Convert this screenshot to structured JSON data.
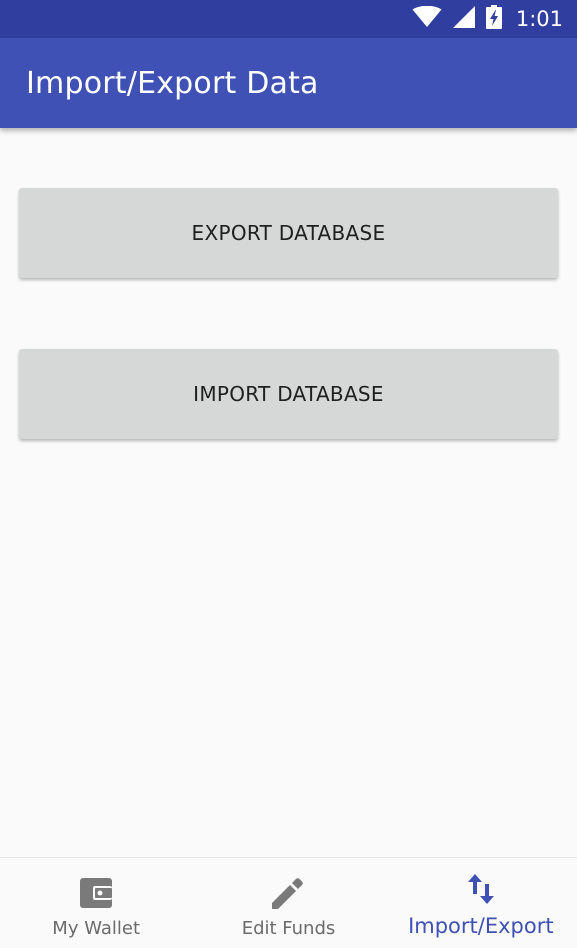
{
  "status_bar": {
    "time": "1:01",
    "icons": [
      "wifi-icon",
      "signal-icon",
      "battery-charging-icon"
    ]
  },
  "app_bar": {
    "title": "Import/Export Data"
  },
  "main": {
    "export_button": "EXPORT DATABASE",
    "import_button": "IMPORT DATABASE"
  },
  "bottom_nav": {
    "items": [
      {
        "label": "My Wallet",
        "icon": "wallet-icon",
        "active": false
      },
      {
        "label": "Edit Funds",
        "icon": "pencil-icon",
        "active": false
      },
      {
        "label": "Import/Export",
        "icon": "swap-vertical-icon",
        "active": true
      }
    ]
  },
  "colors": {
    "status_bar": "#303f9f",
    "primary": "#3f51b5",
    "button_bg": "#d6d7d7",
    "background": "#fafafa",
    "nav_inactive": "#7a7a7a"
  }
}
